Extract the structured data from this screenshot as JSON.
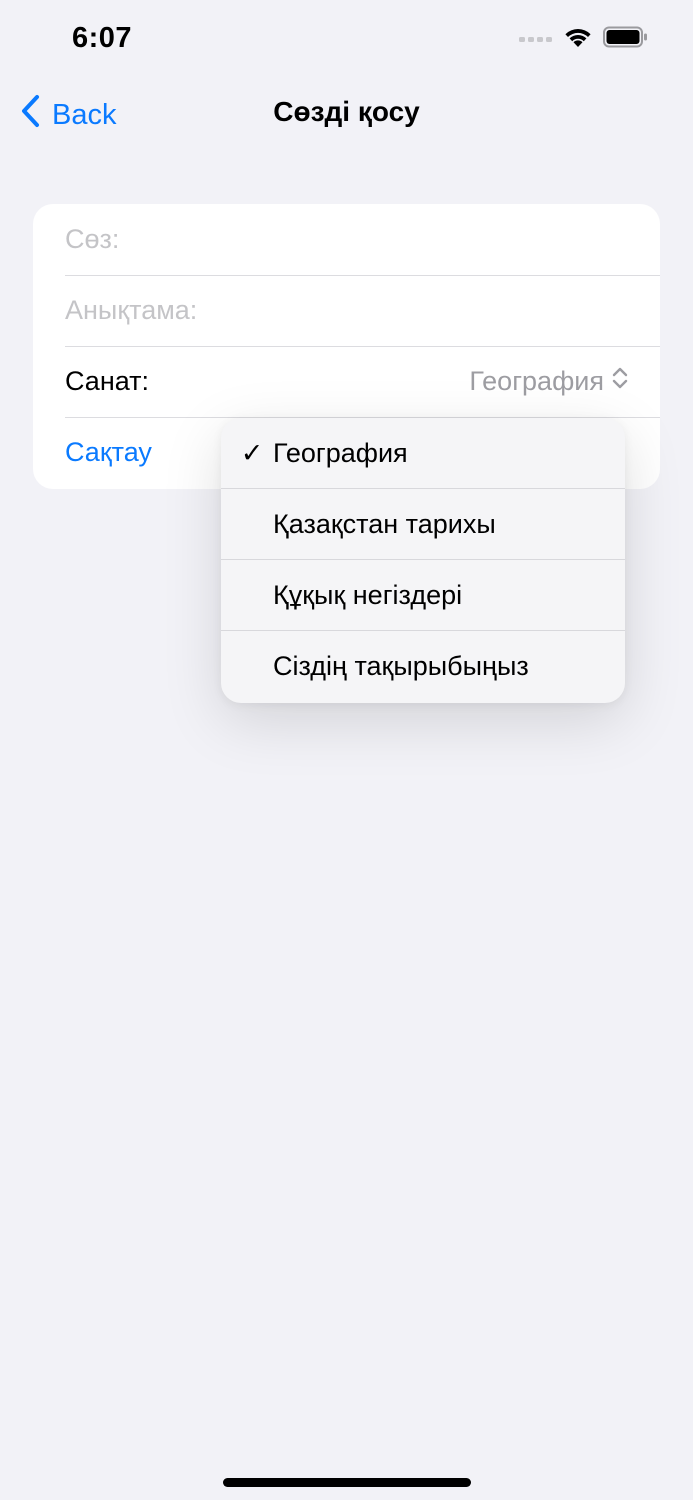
{
  "status_bar": {
    "time": "6:07",
    "icons": [
      "signal-icon",
      "wifi-icon",
      "battery-icon"
    ]
  },
  "nav": {
    "back_label": "Back",
    "title": "Сөзді қосу"
  },
  "form": {
    "word_placeholder": "Сөз:",
    "definition_placeholder": "Анықтама:",
    "category_label": "Санат:",
    "category_value": "География",
    "save_label": "Сақтау"
  },
  "dropdown": {
    "selected_index": 0,
    "options": [
      {
        "label": "География",
        "checked": true
      },
      {
        "label": "Қазақстан тарихы",
        "checked": false
      },
      {
        "label": "Құқық негіздері",
        "checked": false
      },
      {
        "label": "Сіздің тақырыбыңыз",
        "checked": false
      }
    ],
    "check_mark": "✓"
  },
  "colors": {
    "accent": "#0a7aff",
    "background": "#f2f2f7",
    "placeholder": "#c4c4c7"
  }
}
